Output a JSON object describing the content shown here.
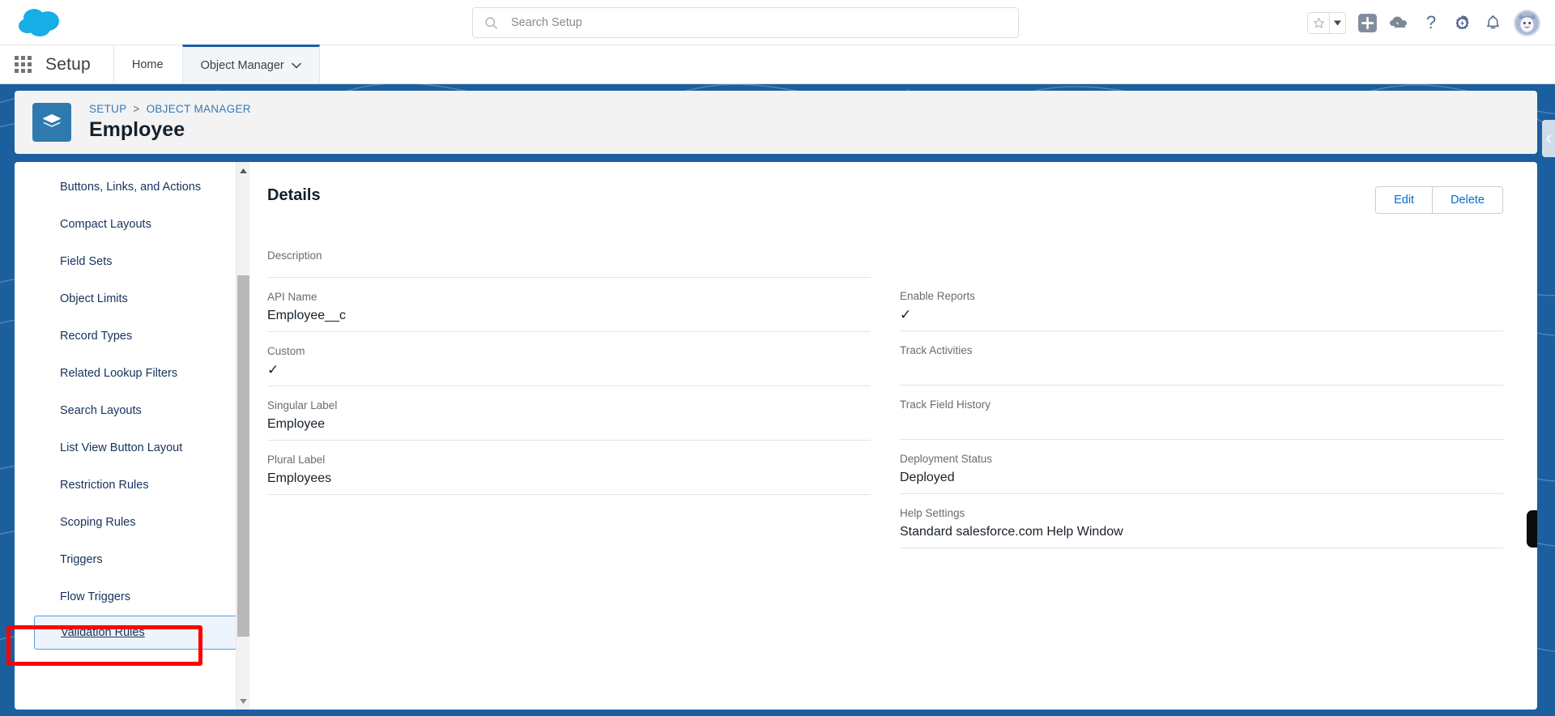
{
  "header": {
    "logo_icon": "salesforce-cloud-logo",
    "search": {
      "placeholder": "Search Setup",
      "value": "",
      "icon": "search-icon"
    },
    "icons": [
      {
        "name": "favorites-star-icon",
        "glyph": "★"
      },
      {
        "name": "favorites-dropdown-icon",
        "glyph": "▼"
      },
      {
        "name": "add-icon",
        "glyph": "+"
      },
      {
        "name": "cloud-terrain-icon",
        "glyph": "⛰"
      },
      {
        "name": "help-icon",
        "glyph": "?"
      },
      {
        "name": "setup-gear-icon",
        "glyph": "⚙"
      },
      {
        "name": "notifications-bell-icon",
        "glyph": "🔔"
      },
      {
        "name": "user-avatar",
        "glyph": ""
      }
    ]
  },
  "setup_nav": {
    "app_launcher_icon": "app-launcher-waffle-icon",
    "title": "Setup",
    "tabs": [
      {
        "label": "Home",
        "active": false,
        "has_caret": false
      },
      {
        "label": "Object Manager",
        "active": true,
        "has_caret": true
      }
    ]
  },
  "breadcrumb": {
    "object_icon": "layers-object-icon",
    "setup_label": "SETUP",
    "separator": ">",
    "object_manager_label": "OBJECT MANAGER",
    "title": "Employee"
  },
  "sidebar": {
    "items": [
      {
        "label": "Buttons, Links, and Actions",
        "selected": false
      },
      {
        "label": "Compact Layouts",
        "selected": false
      },
      {
        "label": "Field Sets",
        "selected": false
      },
      {
        "label": "Object Limits",
        "selected": false
      },
      {
        "label": "Record Types",
        "selected": false
      },
      {
        "label": "Related Lookup Filters",
        "selected": false
      },
      {
        "label": "Search Layouts",
        "selected": false
      },
      {
        "label": "List View Button Layout",
        "selected": false
      },
      {
        "label": "Restriction Rules",
        "selected": false
      },
      {
        "label": "Scoping Rules",
        "selected": false
      },
      {
        "label": "Triggers",
        "selected": false
      },
      {
        "label": "Flow Triggers",
        "selected": false
      },
      {
        "label": "Validation Rules",
        "selected": true
      }
    ],
    "scroll_up_icon": "scroll-up-arrow-icon",
    "scroll_down_icon": "scroll-down-arrow-icon"
  },
  "details": {
    "title": "Details",
    "edit_label": "Edit",
    "delete_label": "Delete",
    "left_fields": [
      {
        "label": "Description",
        "value": "",
        "type": "text"
      },
      {
        "label": "API Name",
        "value": "Employee__c",
        "type": "text"
      },
      {
        "label": "Custom",
        "value": "✓",
        "type": "check"
      },
      {
        "label": "Singular Label",
        "value": "Employee",
        "type": "text"
      },
      {
        "label": "Plural Label",
        "value": "Employees",
        "type": "text"
      }
    ],
    "right_fields": [
      {
        "label": "Enable Reports",
        "value": "✓",
        "type": "check"
      },
      {
        "label": "Track Activities",
        "value": "",
        "type": "text"
      },
      {
        "label": "Track Field History",
        "value": "",
        "type": "text"
      },
      {
        "label": "Deployment Status",
        "value": "Deployed",
        "type": "text"
      },
      {
        "label": "Help Settings",
        "value": "Standard salesforce.com Help Window",
        "type": "text"
      }
    ]
  },
  "annotation": {
    "target": "Validation Rules",
    "color": "#ff0000"
  },
  "colors": {
    "brand_blue": "#1b5f9e",
    "link_blue": "#0070d2",
    "object_icon_blue": "#2e7ab0",
    "annotation_red": "#ff0000",
    "selected_bg": "#eef4fb"
  }
}
